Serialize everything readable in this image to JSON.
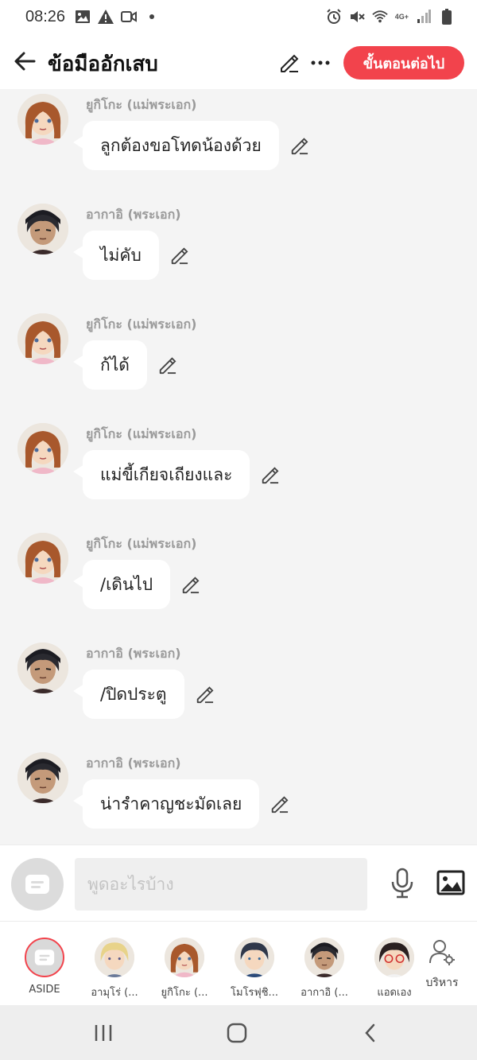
{
  "status_bar": {
    "time": "08:26",
    "left_icons": [
      "image-icon",
      "warning-icon",
      "video-icon",
      "dot-icon"
    ],
    "network": "4G+",
    "right_icons": [
      "alarm-icon",
      "mute-icon",
      "wifi-icon",
      "signal-icon",
      "battery-icon"
    ]
  },
  "header": {
    "title": "ข้อมืออักเสบ",
    "next_button": "ขั้นตอนต่อไป",
    "accent_color": "#f2434c"
  },
  "messages": [
    {
      "sender": "ยูกิโกะ (แม่พระเอก)",
      "text": "ลูกต้องขอโทดน้องด้วย",
      "character": "yukiko"
    },
    {
      "sender": "อากาอิ (พระเอก)",
      "text": "ไม่คับ",
      "character": "akai"
    },
    {
      "sender": "ยูกิโกะ (แม่พระเอก)",
      "text": "ก้ได้",
      "character": "yukiko"
    },
    {
      "sender": "ยูกิโกะ (แม่พระเอก)",
      "text": "แม่ขี้เกียจเถียงและ",
      "character": "yukiko"
    },
    {
      "sender": "ยูกิโกะ (แม่พระเอก)",
      "text": "/เดินไป",
      "character": "yukiko"
    },
    {
      "sender": "อากาอิ (พระเอก)",
      "text": "/ปิดประตู",
      "character": "akai"
    },
    {
      "sender": "อากาอิ (พระเอก)",
      "text": "น่ารำคาญชะมัดเลย",
      "character": "akai"
    }
  ],
  "composer": {
    "placeholder": "พูดอะไรบ้าง"
  },
  "characters": [
    {
      "name": "ASIDE",
      "type": "aside"
    },
    {
      "name": "อามุโร่ (...",
      "type": "amuro"
    },
    {
      "name": "ยูกิโกะ (...",
      "type": "yukiko"
    },
    {
      "name": "โมโรฟุชิ...",
      "type": "morofushi"
    },
    {
      "name": "อากาอิ (...",
      "type": "akai"
    },
    {
      "name": "แอดเอง",
      "type": "admin"
    }
  ],
  "manage_label": "บริหาร"
}
